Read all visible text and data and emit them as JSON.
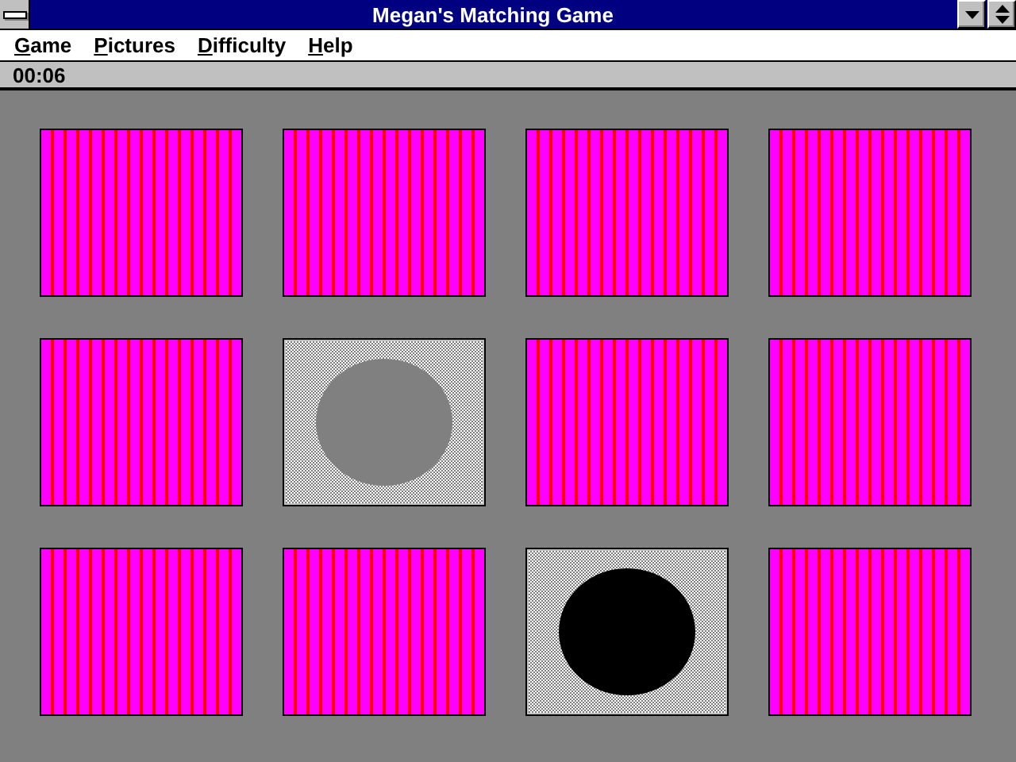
{
  "window": {
    "title": "Megan's Matching Game"
  },
  "menu": [
    {
      "label": "Game"
    },
    {
      "label": "Pictures"
    },
    {
      "label": "Difficulty"
    },
    {
      "label": "Help"
    }
  ],
  "status_bar": {
    "timer": "00:06"
  },
  "cards": [
    {
      "kind": "back"
    },
    {
      "kind": "back"
    },
    {
      "kind": "back"
    },
    {
      "kind": "back"
    },
    {
      "kind": "back"
    },
    {
      "kind": "face",
      "color": "#808080"
    },
    {
      "kind": "back"
    },
    {
      "kind": "back"
    },
    {
      "kind": "back"
    },
    {
      "kind": "back"
    },
    {
      "kind": "face",
      "color": "#000000"
    },
    {
      "kind": "back"
    }
  ]
}
